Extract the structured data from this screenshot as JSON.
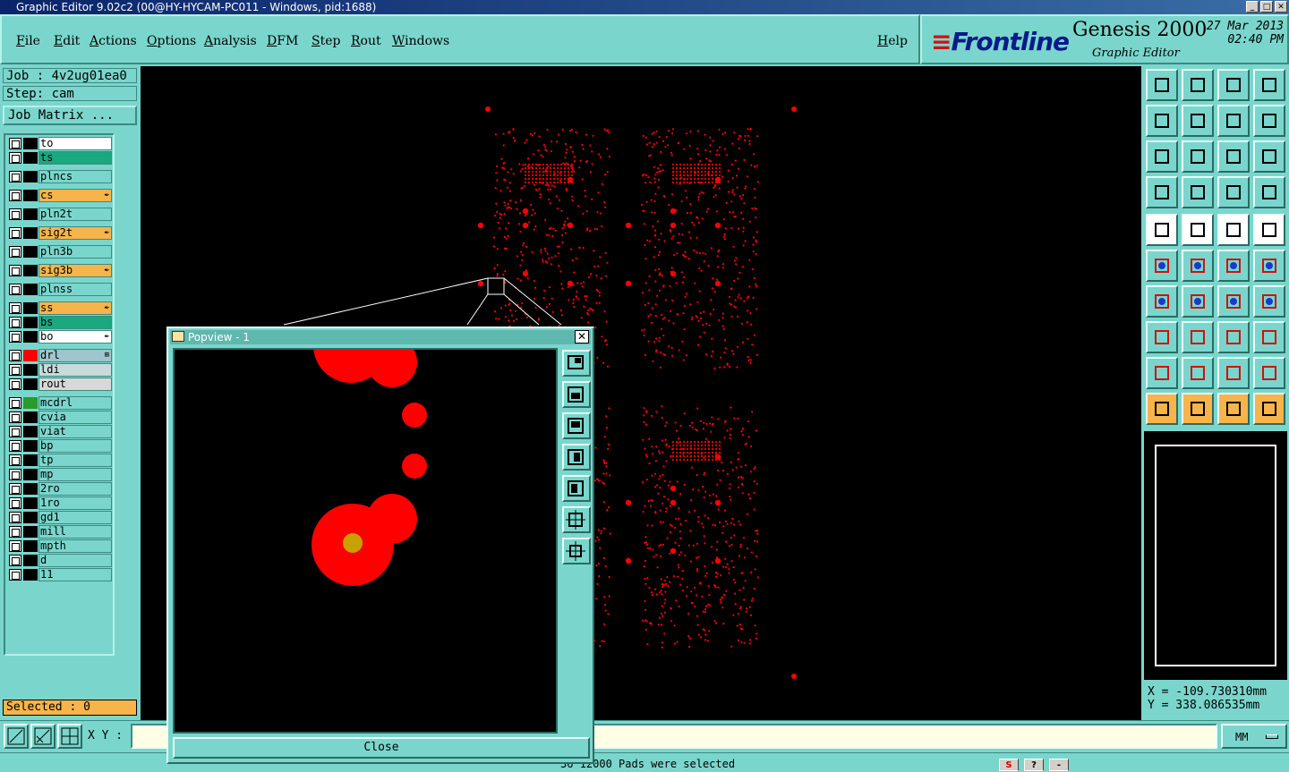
{
  "window": {
    "title": "Graphic Editor 9.02c2 (00@HY-HYCAM-PC011 - Windows, pid:1688)"
  },
  "menu": {
    "items": [
      "File",
      "Edit",
      "Actions",
      "Options",
      "Analysis",
      "DFM",
      "Step",
      "Rout",
      "Windows"
    ],
    "help": "Help"
  },
  "brand": {
    "logo": "Frontline",
    "product": "Genesis 2000",
    "subtitle": "Graphic Editor",
    "date": "27 Mar 2013",
    "time": "02:40 PM"
  },
  "job": {
    "job_label": "Job : 4v2ug01ea0",
    "step_label": "Step: cam",
    "matrix_button": "Job Matrix ..."
  },
  "layers": [
    {
      "name": "to",
      "bg": "#ffffff",
      "color": "#000000",
      "pen": ""
    },
    {
      "name": "ts",
      "bg": "#1aa87e",
      "color": "#000000",
      "pen": ""
    },
    {
      "name": "plncs",
      "bg": "#7ad6cc",
      "color": "#000000",
      "pen": ""
    },
    {
      "name": "cs",
      "bg": "#f6b44a",
      "color": "#000000",
      "pen": "✒"
    },
    {
      "name": "pln2t",
      "bg": "#7ad6cc",
      "color": "#000000",
      "pen": ""
    },
    {
      "name": "sig2t",
      "bg": "#f6b44a",
      "color": "#000000",
      "pen": "✒"
    },
    {
      "name": "pln3b",
      "bg": "#7ad6cc",
      "color": "#000000",
      "pen": ""
    },
    {
      "name": "sig3b",
      "bg": "#f6b44a",
      "color": "#000000",
      "pen": "✒"
    },
    {
      "name": "plnss",
      "bg": "#7ad6cc",
      "color": "#000000",
      "pen": ""
    },
    {
      "name": "ss",
      "bg": "#f6b44a",
      "color": "#000000",
      "pen": "✒"
    },
    {
      "name": "bs",
      "bg": "#1aa87e",
      "color": "#000000",
      "pen": ""
    },
    {
      "name": "bo",
      "bg": "#ffffff",
      "color": "#000000",
      "pen": "✒"
    },
    {
      "name": "drl",
      "bg": "#9ec6cc",
      "color": "#ff0000",
      "pen": "⊞"
    },
    {
      "name": "ldi",
      "bg": "#c8dada",
      "color": "#000000",
      "pen": ""
    },
    {
      "name": "rout",
      "bg": "#d8d8d8",
      "color": "#000000",
      "pen": ""
    },
    {
      "name": "mcdrl",
      "bg": "#7ad6cc",
      "color": "#2a9a2a",
      "pen": ""
    },
    {
      "name": "cvia",
      "bg": "#7ad6cc",
      "color": "#000000",
      "pen": ""
    },
    {
      "name": "viat",
      "bg": "#7ad6cc",
      "color": "#000000",
      "pen": ""
    },
    {
      "name": "bp",
      "bg": "#7ad6cc",
      "color": "#000000",
      "pen": ""
    },
    {
      "name": "tp",
      "bg": "#7ad6cc",
      "color": "#000000",
      "pen": ""
    },
    {
      "name": "mp",
      "bg": "#7ad6cc",
      "color": "#000000",
      "pen": ""
    },
    {
      "name": "2ro",
      "bg": "#7ad6cc",
      "color": "#000000",
      "pen": ""
    },
    {
      "name": "1ro",
      "bg": "#7ad6cc",
      "color": "#000000",
      "pen": ""
    },
    {
      "name": "gd1",
      "bg": "#7ad6cc",
      "color": "#000000",
      "pen": ""
    },
    {
      "name": "mill",
      "bg": "#7ad6cc",
      "color": "#000000",
      "pen": ""
    },
    {
      "name": "mpth",
      "bg": "#7ad6cc",
      "color": "#000000",
      "pen": ""
    },
    {
      "name": "d",
      "bg": "#7ad6cc",
      "color": "#000000",
      "pen": ""
    },
    {
      "name": "11",
      "bg": "#7ad6cc",
      "color": "#000000",
      "pen": ""
    }
  ],
  "selected": "Selected : 0",
  "coords": {
    "x": "X = -109.730310mm",
    "y": "Y = 338.086535mm"
  },
  "bottom": {
    "xy_label": "X Y :",
    "xy_value": "",
    "units": "MM"
  },
  "status": {
    "message": "36 12000 Pads were selected"
  },
  "popview": {
    "title": "Popview - 1",
    "close_label": "Close",
    "close_x": "✕"
  },
  "colors": {
    "panel": "#7ad6cc",
    "feature": "#ff0000",
    "highlight": "#f6b44a",
    "canvas": "#000000"
  }
}
